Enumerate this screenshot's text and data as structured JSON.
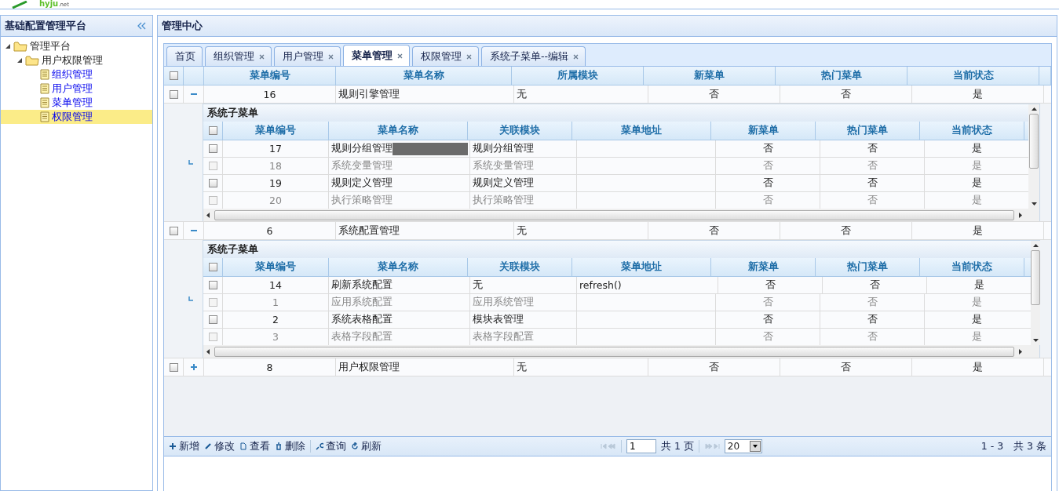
{
  "logo": {
    "name": "hyju",
    "suffix": ".net"
  },
  "sidebar": {
    "title": "基础配置管理平台",
    "tree": [
      {
        "label": "管理平台",
        "kind": "folder",
        "expanded": true,
        "selected": false,
        "children": [
          {
            "label": "用户权限管理",
            "kind": "folder",
            "expanded": true,
            "selected": false,
            "children": [
              {
                "label": "组织管理",
                "kind": "file",
                "selected": false
              },
              {
                "label": "用户管理",
                "kind": "file",
                "selected": false
              },
              {
                "label": "菜单管理",
                "kind": "file",
                "selected": false
              },
              {
                "label": "权限管理",
                "kind": "file",
                "selected": true
              }
            ]
          }
        ]
      }
    ]
  },
  "main": {
    "title": "管理中心",
    "tabs": [
      {
        "label": "首页",
        "closable": false,
        "selected": false
      },
      {
        "label": "组织管理",
        "closable": true,
        "selected": false
      },
      {
        "label": "用户管理",
        "closable": true,
        "selected": false
      },
      {
        "label": "菜单管理",
        "closable": true,
        "selected": true
      },
      {
        "label": "权限管理",
        "closable": true,
        "selected": false
      },
      {
        "label": "系统子菜单--编辑",
        "closable": true,
        "selected": false
      }
    ],
    "grid": {
      "all_checked": false,
      "columns": [
        "菜单编号",
        "菜单名称",
        "所属模块",
        "新菜单",
        "热门菜单",
        "当前状态"
      ],
      "rows": [
        {
          "cells": [
            "16",
            "规则引擎管理",
            "无",
            "否",
            "否",
            "是"
          ],
          "checked": false,
          "expanded": true,
          "subgrid": {
            "title": "系统子菜单",
            "all_checked": false,
            "columns": [
              "菜单编号",
              "菜单名称",
              "关联模块",
              "菜单地址",
              "新菜单",
              "热门菜单",
              "当前状态"
            ],
            "rows": [
              {
                "cells": [
                  "17",
                  "规则分组管理",
                  "规则分组管理",
                  "",
                  "否",
                  "否",
                  "是"
                ],
                "checked": false,
                "disabled": false,
                "editing": true
              },
              {
                "cells": [
                  "18",
                  "系统变量管理",
                  "系统变量管理",
                  "",
                  "否",
                  "否",
                  "是"
                ],
                "checked": false,
                "disabled": true,
                "editing": false
              },
              {
                "cells": [
                  "19",
                  "规则定义管理",
                  "规则定义管理",
                  "",
                  "否",
                  "否",
                  "是"
                ],
                "checked": false,
                "disabled": false,
                "editing": false
              },
              {
                "cells": [
                  "20",
                  "执行策略管理",
                  "执行策略管理",
                  "",
                  "否",
                  "否",
                  "是"
                ],
                "checked": false,
                "disabled": true,
                "editing": false
              }
            ]
          }
        },
        {
          "cells": [
            "6",
            "系统配置管理",
            "无",
            "否",
            "否",
            "是"
          ],
          "checked": false,
          "expanded": true,
          "subgrid": {
            "title": "系统子菜单",
            "all_checked": false,
            "columns": [
              "菜单编号",
              "菜单名称",
              "关联模块",
              "菜单地址",
              "新菜单",
              "热门菜单",
              "当前状态"
            ],
            "rows": [
              {
                "cells": [
                  "14",
                  "刷新系统配置",
                  "无",
                  "refresh()",
                  "否",
                  "否",
                  "是"
                ],
                "checked": false,
                "disabled": false,
                "editing": false
              },
              {
                "cells": [
                  "1",
                  "应用系统配置",
                  "应用系统管理",
                  "",
                  "否",
                  "否",
                  "是"
                ],
                "checked": false,
                "disabled": true,
                "editing": false
              },
              {
                "cells": [
                  "2",
                  "系统表格配置",
                  "模块表管理",
                  "",
                  "否",
                  "否",
                  "是"
                ],
                "checked": false,
                "disabled": false,
                "editing": false
              },
              {
                "cells": [
                  "3",
                  "表格字段配置",
                  "表格字段配置",
                  "",
                  "否",
                  "否",
                  "是"
                ],
                "checked": false,
                "disabled": true,
                "editing": false
              }
            ]
          }
        },
        {
          "cells": [
            "8",
            "用户权限管理",
            "无",
            "否",
            "否",
            "是"
          ],
          "checked": false,
          "expanded": false
        }
      ]
    },
    "toolbar": [
      "新增",
      "修改",
      "查看",
      "删除",
      "查询",
      "刷新"
    ],
    "pager": {
      "page": "1",
      "pages": "共 1 页",
      "page_size": "20",
      "summary": "1 - 3　共 3 条"
    }
  }
}
